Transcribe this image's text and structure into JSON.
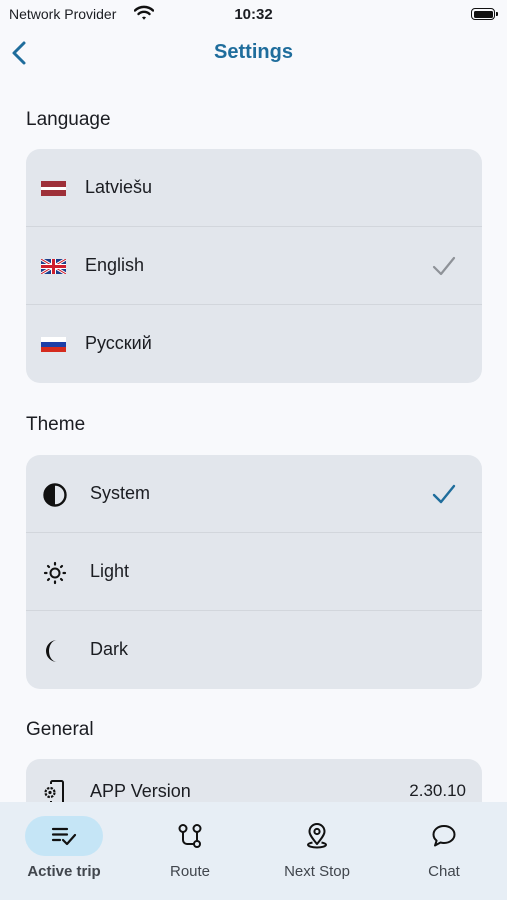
{
  "status_bar": {
    "carrier": "Network Provider",
    "time": "10:32"
  },
  "header": {
    "title": "Settings",
    "back_icon": "chevron-left-icon"
  },
  "language": {
    "title": "Language",
    "items": [
      {
        "label": "Latviešu",
        "flag": "latvia-flag-icon",
        "selected": false
      },
      {
        "label": "English",
        "flag": "uk-flag-icon",
        "selected": true
      },
      {
        "label": "Русский",
        "flag": "russia-flag-icon",
        "selected": false
      }
    ],
    "check_color": "#8e9298"
  },
  "theme": {
    "title": "Theme",
    "items": [
      {
        "label": "System",
        "icon": "half-circle-icon",
        "selected": true
      },
      {
        "label": "Light",
        "icon": "sun-icon",
        "selected": false
      },
      {
        "label": "Dark",
        "icon": "moon-icon",
        "selected": false
      }
    ],
    "check_color": "#1f6d9c"
  },
  "general": {
    "title": "General",
    "app_version": {
      "label": "APP Version",
      "value": "2.30.10",
      "icon": "phone-settings-icon"
    }
  },
  "tabs": [
    {
      "label": "Active trip",
      "icon": "checklist-icon",
      "active": true
    },
    {
      "label": "Route",
      "icon": "route-icon",
      "active": false
    },
    {
      "label": "Next Stop",
      "icon": "location-pin-icon",
      "active": false
    },
    {
      "label": "Chat",
      "icon": "chat-bubble-icon",
      "active": false
    }
  ],
  "colors": {
    "accent": "#1f6d9c",
    "background": "#f8f9fc",
    "card": "#e2e6ec",
    "tabbar": "#e7eef5",
    "active_tab_pill": "#c5e5f6"
  }
}
